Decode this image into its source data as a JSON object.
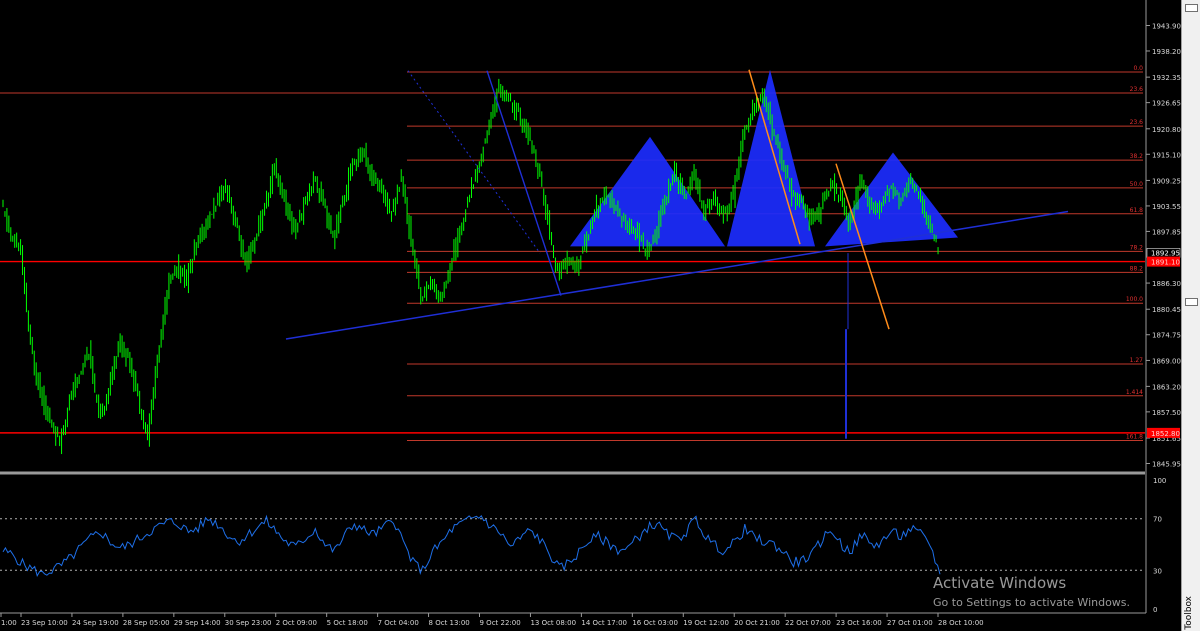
{
  "chart_data": [
    {
      "type": "line",
      "subtype": "candlestick price chart",
      "price_ticks": [
        "1943.90",
        "1938.20",
        "1932.35",
        "1926.65",
        "1920.80",
        "1915.10",
        "1909.25",
        "1903.55",
        "1897.85",
        "1886.30",
        "1880.45",
        "1874.75",
        "1869.00",
        "1863.20",
        "1857.50",
        "1851.65",
        "1845.95"
      ],
      "current_price_label": "1892.95",
      "horizontal_lines": [
        {
          "price": 1891.1,
          "label": "1891.10",
          "color": "#ff0000"
        },
        {
          "price": 1852.8,
          "label": "1852.80",
          "color": "#ff0000"
        }
      ],
      "fibonacci": {
        "color": "#c0392b",
        "levels": [
          {
            "label": "0.0",
            "price": 1933.5
          },
          {
            "label": "23.6",
            "price": 1928.8
          },
          {
            "label": "23.6",
            "price": 1921.4
          },
          {
            "label": "38.2",
            "price": 1913.8
          },
          {
            "label": "50.0",
            "price": 1907.6
          },
          {
            "label": "61.8",
            "price": 1901.8
          },
          {
            "label": "78.2",
            "price": 1893.4
          },
          {
            "label": "88.2",
            "price": 1888.7
          },
          {
            "label": "100.0",
            "price": 1881.8
          },
          {
            "label": "1.27",
            "price": 1868.2
          },
          {
            "label": "1.414",
            "price": 1861.1
          },
          {
            "label": "161.8",
            "price": 1851.1
          }
        ]
      },
      "series": [
        {
          "color": "#00ff00",
          "values": [
            1904,
            1897,
            1893,
            1872,
            1862,
            1855,
            1851,
            1860,
            1866,
            1871,
            1856,
            1862,
            1873,
            1870,
            1861,
            1852,
            1869,
            1885,
            1890,
            1887,
            1895,
            1899,
            1904,
            1908,
            1900,
            1890,
            1896,
            1903,
            1912,
            1905,
            1898,
            1903,
            1910,
            1905,
            1896,
            1904,
            1913,
            1916,
            1910,
            1907,
            1902,
            1910,
            1896,
            1883,
            1886,
            1883,
            1890,
            1898,
            1906,
            1913,
            1922,
            1930,
            1927,
            1924,
            1919,
            1912,
            1900,
            1888,
            1892,
            1889,
            1897,
            1903,
            1906,
            1903,
            1899,
            1898,
            1893,
            1897,
            1905,
            1911,
            1906,
            1911,
            1902,
            1905,
            1901,
            1906,
            1919,
            1925,
            1929,
            1921,
            1913,
            1906,
            1904,
            1900,
            1903,
            1909,
            1905,
            1899,
            1910,
            1904,
            1902,
            1908,
            1905,
            1909,
            1906,
            1899,
            1894
          ]
        }
      ],
      "x_tick_labels": [
        "1:00",
        "23 Sep 10:00",
        "24 Sep 19:00",
        "28 Sep 05:00",
        "29 Sep 14:00",
        "30 Sep 23:00",
        "2 Oct 09:00",
        "5 Oct 18:00",
        "7 Oct 04:00",
        "8 Oct 13:00",
        "9 Oct 22:00",
        "13 Oct 08:00",
        "14 Oct 17:00",
        "16 Oct 03:00",
        "19 Oct 12:00",
        "20 Oct 21:00",
        "22 Oct 07:00",
        "23 Oct 16:00",
        "27 Oct 01:00",
        "28 Oct 10:00"
      ],
      "grid": false,
      "pattern_note": "head and shoulders"
    },
    {
      "type": "line",
      "subtype": "oscillator",
      "y_ticks": [
        "100",
        "70",
        "30",
        "0"
      ],
      "levels": [
        70,
        30
      ],
      "ylim": [
        0,
        100
      ],
      "series": [
        {
          "color": "#1e6fe8",
          "values": [
            45,
            42,
            35,
            31,
            27,
            30,
            34,
            40,
            48,
            55,
            60,
            52,
            47,
            50,
            55,
            60,
            64,
            68,
            66,
            60,
            63,
            70,
            66,
            58,
            52,
            57,
            63,
            68,
            60,
            52,
            48,
            55,
            62,
            50,
            45,
            57,
            66,
            61,
            58,
            63,
            70,
            52,
            36,
            30,
            44,
            52,
            62,
            66,
            70,
            72,
            64,
            59,
            48,
            55,
            61,
            54,
            43,
            31,
            36,
            44,
            53,
            56,
            51,
            46,
            47,
            55,
            63,
            66,
            58,
            54,
            60,
            70,
            56,
            49,
            45,
            52,
            62,
            55,
            52,
            50,
            44,
            36,
            38,
            43,
            55,
            61,
            48,
            46,
            58,
            49,
            52,
            60,
            56,
            62,
            58,
            50,
            27
          ]
        }
      ]
    }
  ],
  "toolbox": {
    "label": "Toolbox"
  },
  "watermark": {
    "title": "Activate Windows",
    "subtitle": "Go to Settings to activate Windows."
  },
  "colors": {
    "background": "#000000",
    "axis": "#9a9a9a",
    "candles": "#00ff00",
    "pattern_fill": "#1c2cff",
    "trendline": "#1f2fd6",
    "orange_line": "#ff8c1a",
    "fib_line": "#c0392b",
    "hline": "#ff0000",
    "oscillator": "#1e6fe8"
  }
}
